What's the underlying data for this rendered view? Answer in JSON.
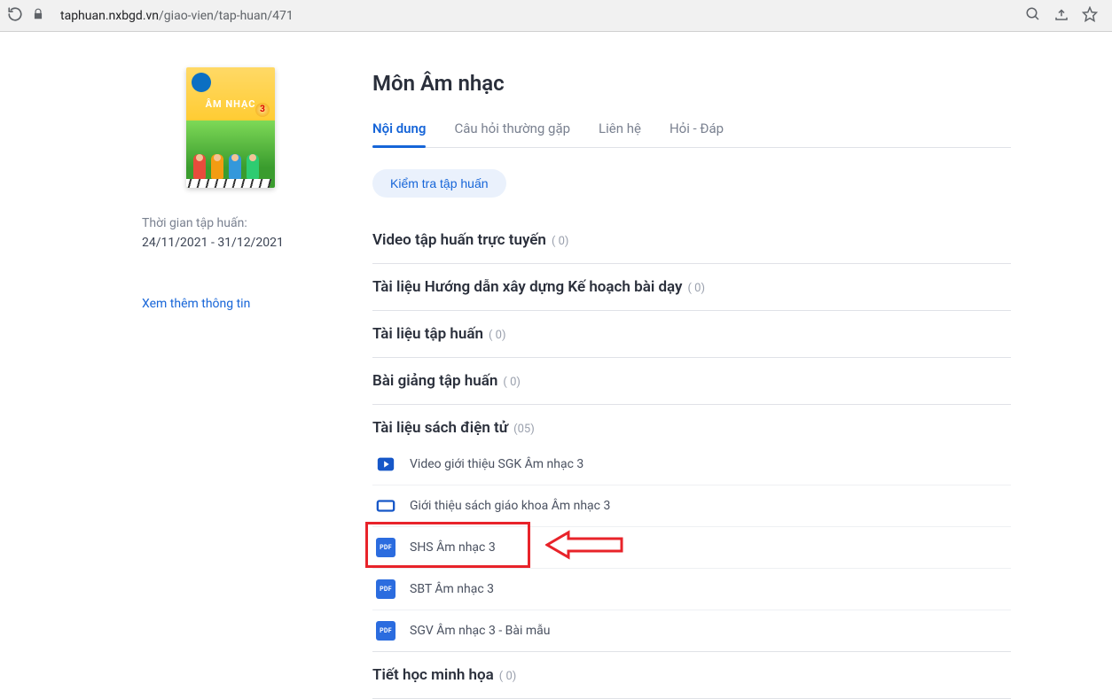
{
  "browser": {
    "url_host": "taphuan.nxbgd.vn",
    "url_path": "/giao-vien/tap-huan/471"
  },
  "sidebar": {
    "cover_title": "ÂM NHẠC",
    "cover_badge": "3",
    "period_label": "Thời gian tập huấn:",
    "period_dates": "24/11/2021 - 31/12/2021",
    "more_info": "Xem thêm thông tin"
  },
  "main": {
    "title": "Môn Âm nhạc",
    "tabs": [
      "Nội dung",
      "Câu hỏi thường gặp",
      "Liên hệ",
      "Hỏi - Đáp"
    ],
    "exam_button": "Kiểm tra tập huấn",
    "sections": [
      {
        "title": "Video tập huấn trực tuyến",
        "count": "( 0)"
      },
      {
        "title": "Tài liệu Hướng dẫn xây dựng Kế hoạch bài dạy",
        "count": "( 0)"
      },
      {
        "title": "Tài liệu tập huấn",
        "count": "( 0)"
      },
      {
        "title": "Bài giảng tập huấn",
        "count": "( 0)"
      },
      {
        "title": "Tài liệu sách điện tử",
        "count": "(05)",
        "items": [
          {
            "icon": "video",
            "label": "Video giới thiệu SGK Âm nhạc 3"
          },
          {
            "icon": "slide",
            "label": "Giới thiệu sách giáo khoa Âm nhạc 3"
          },
          {
            "icon": "pdf",
            "label": "SHS Âm nhạc 3"
          },
          {
            "icon": "pdf",
            "label": "SBT Âm nhạc 3"
          },
          {
            "icon": "pdf",
            "label": "SGV Âm nhạc 3 - Bài mẫu"
          }
        ]
      },
      {
        "title": "Tiết học minh họa",
        "count": "( 0)"
      }
    ]
  },
  "annotation": {
    "highlighted_item_index": 2
  }
}
